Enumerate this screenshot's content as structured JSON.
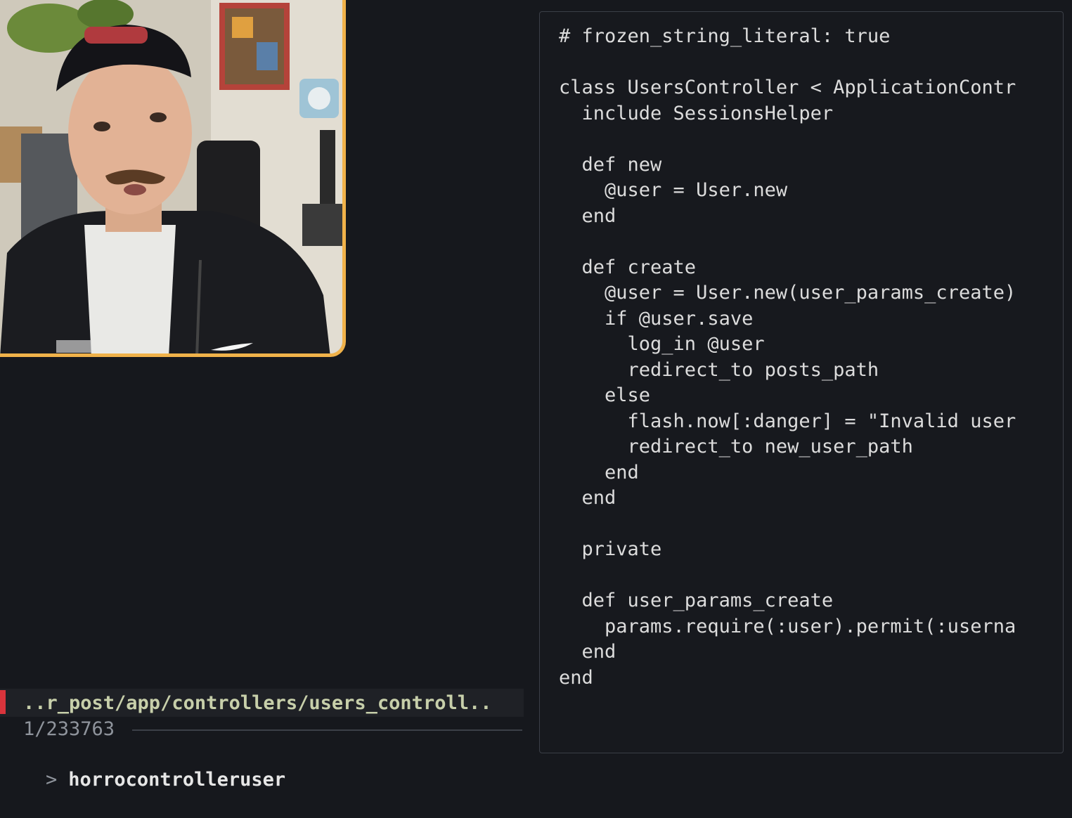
{
  "webcam": {
    "label": "presenter-webcam",
    "border_color": "#f0b24a"
  },
  "preview": {
    "lines": [
      "# frozen_string_literal: true",
      "",
      "class UsersController < ApplicationContr",
      "  include SessionsHelper",
      "",
      "  def new",
      "    @user = User.new",
      "  end",
      "",
      "  def create",
      "    @user = User.new(user_params_create)",
      "    if @user.save",
      "      log_in @user",
      "      redirect_to posts_path",
      "    else",
      "      flash.now[:danger] = \"Invalid user",
      "      redirect_to new_user_path",
      "    end",
      "  end",
      "",
      "  private",
      "",
      "  def user_params_create",
      "    params.require(:user).permit(:userna",
      "  end",
      "end"
    ]
  },
  "finder": {
    "selected_result": "..r_post/app/controllers/users_controll..",
    "count": "1/233763",
    "prompt_symbol": ">",
    "query": "horrocontrolleruser"
  },
  "colors": {
    "background": "#16181d",
    "text": "#dcdcdc",
    "marker": "#d9343c"
  }
}
